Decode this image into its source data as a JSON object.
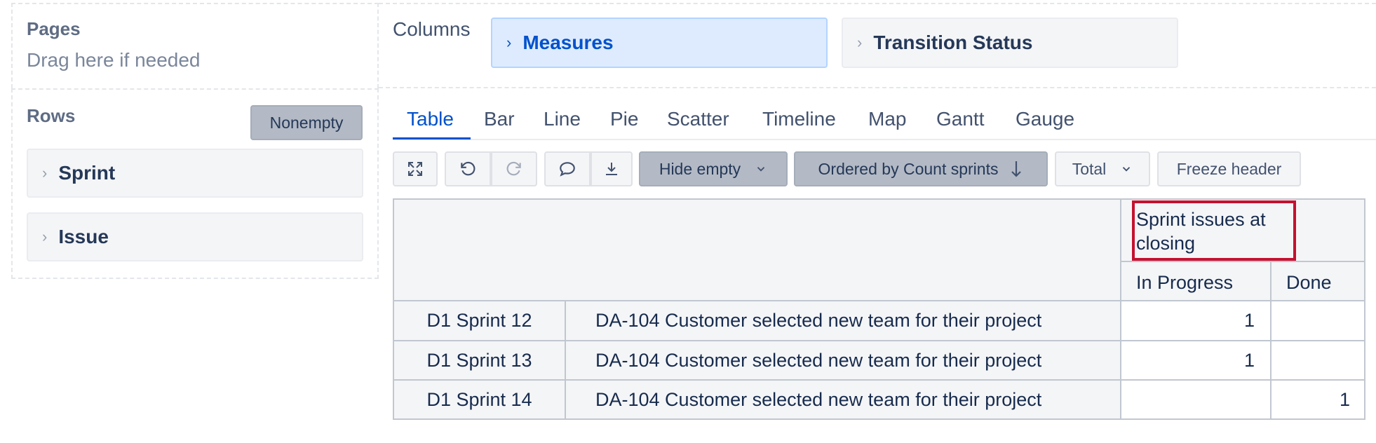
{
  "pages": {
    "title": "Pages",
    "hint": "Drag here if needed"
  },
  "columns": {
    "title": "Columns",
    "items": [
      "Measures",
      "Transition Status"
    ]
  },
  "rows": {
    "title": "Rows",
    "nonempty_label": "Nonempty",
    "items": [
      "Sprint",
      "Issue"
    ]
  },
  "tabs": [
    "Table",
    "Bar",
    "Line",
    "Pie",
    "Scatter",
    "Timeline",
    "Map",
    "Gantt",
    "Gauge"
  ],
  "active_tab": "Table",
  "toolbar": {
    "hide_empty": "Hide empty",
    "ordered_by": "Ordered by Count sprints",
    "total": "Total",
    "freeze_header": "Freeze header",
    "icons": [
      "expand-icon",
      "undo-icon",
      "redo-icon",
      "comment-icon",
      "download-icon"
    ]
  },
  "table": {
    "measure_header": "Sprint issues at closing",
    "status_headers": [
      "In Progress",
      "Done"
    ],
    "rows": [
      {
        "sprint": "D1 Sprint 12",
        "issue": "DA-104 Customer selected new team for their project",
        "in_progress": "1",
        "done": ""
      },
      {
        "sprint": "D1 Sprint 13",
        "issue": "DA-104 Customer selected new team for their project",
        "in_progress": "1",
        "done": ""
      },
      {
        "sprint": "D1 Sprint 14",
        "issue": "DA-104 Customer selected new team for their project",
        "in_progress": "",
        "done": "1"
      }
    ]
  },
  "colors": {
    "accent": "#0052cc",
    "highlight": "#c4122f",
    "pill_blue_bg": "#deebff"
  }
}
